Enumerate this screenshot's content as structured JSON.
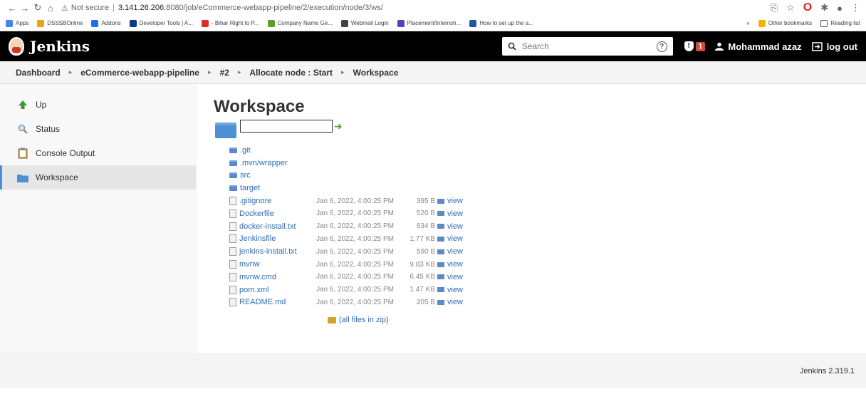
{
  "browser": {
    "security_label": "Not secure",
    "url_host": "3.141.26.206",
    "url_path": ":8080/job/eCommerce-webapp-pipeline/2/execution/node/3/ws/"
  },
  "bookmarks": {
    "items": [
      {
        "label": "Apps",
        "color": "#4285f4"
      },
      {
        "label": "DSSSBOnline",
        "color": "#e8a317"
      },
      {
        "label": "Addons",
        "color": "#1a73e8"
      },
      {
        "label": "Developer Tools | A...",
        "color": "#0b3b8c"
      },
      {
        "label": "- Bihar Right to P...",
        "color": "#d93025"
      },
      {
        "label": "Company Name Ge...",
        "color": "#5aa02c"
      },
      {
        "label": "Webmail Login",
        "color": "#444"
      },
      {
        "label": "Placement/Internsh...",
        "color": "#5a3fc0"
      },
      {
        "label": "How to set up the a...",
        "color": "#1a5aa0"
      }
    ],
    "more": "»",
    "other": "Other bookmarks",
    "reading": "Reading list"
  },
  "header": {
    "brand": "Jenkins",
    "search_placeholder": "Search",
    "help": "?",
    "alert_count": "1",
    "user": "Mohammad azaz",
    "logout": "log out"
  },
  "breadcrumb": [
    "Dashboard",
    "eCommerce-webapp-pipeline",
    "#2",
    "Allocate node : Start",
    "Workspace"
  ],
  "sidebar": [
    {
      "label": "Up",
      "icon": "up-arrow-icon"
    },
    {
      "label": "Status",
      "icon": "magnifier-icon"
    },
    {
      "label": "Console Output",
      "icon": "clipboard-icon"
    },
    {
      "label": "Workspace",
      "icon": "folder-icon"
    }
  ],
  "page": {
    "title": "Workspace",
    "zip_label": "(all files in zip)"
  },
  "files": [
    {
      "name": ".git",
      "type": "dir"
    },
    {
      "name": ".mvn/wrapper",
      "type": "dir"
    },
    {
      "name": "src",
      "type": "dir"
    },
    {
      "name": "target",
      "type": "dir"
    },
    {
      "name": ".gitignore",
      "type": "file",
      "date": "Jan 6, 2022, 4:00:25 PM",
      "size": "395 B",
      "view": "view"
    },
    {
      "name": "Dockerfile",
      "type": "file",
      "date": "Jan 6, 2022, 4:00:25 PM",
      "size": "520 B",
      "view": "view"
    },
    {
      "name": "docker-install.txt",
      "type": "file",
      "date": "Jan 6, 2022, 4:00:25 PM",
      "size": "634 B",
      "view": "view"
    },
    {
      "name": "Jenkinsfile",
      "type": "file",
      "date": "Jan 6, 2022, 4:00:25 PM",
      "size": "1.77 KB",
      "view": "view"
    },
    {
      "name": "jenkins-install.txt",
      "type": "file",
      "date": "Jan 6, 2022, 4:00:25 PM",
      "size": "590 B",
      "view": "view"
    },
    {
      "name": "mvnw",
      "type": "file",
      "date": "Jan 6, 2022, 4:00:25 PM",
      "size": "9.83 KB",
      "view": "view"
    },
    {
      "name": "mvnw.cmd",
      "type": "file",
      "date": "Jan 6, 2022, 4:00:25 PM",
      "size": "6.45 KB",
      "view": "view"
    },
    {
      "name": "pom.xml",
      "type": "file",
      "date": "Jan 6, 2022, 4:00:25 PM",
      "size": "1.47 KB",
      "view": "view"
    },
    {
      "name": "README.md",
      "type": "file",
      "date": "Jan 6, 2022, 4:00:25 PM",
      "size": "205 B",
      "view": "view"
    }
  ],
  "footer": {
    "version": "Jenkins 2.319.1"
  }
}
